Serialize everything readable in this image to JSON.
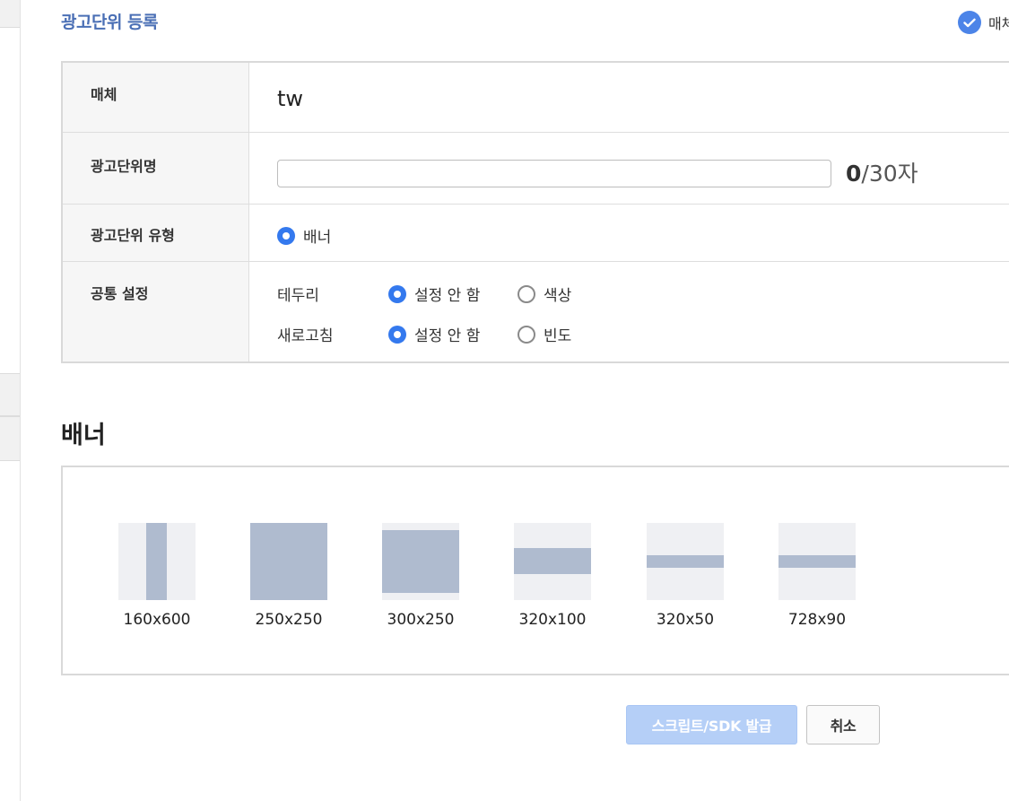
{
  "page": {
    "title": "광고단위 등록",
    "top_right_label": "매체"
  },
  "form": {
    "media": {
      "label": "매체",
      "value": "tw"
    },
    "unit_name": {
      "label": "광고단위명",
      "value": "",
      "placeholder": "",
      "count_current": "0",
      "count_suffix": "/30자"
    },
    "unit_type": {
      "label": "광고단위 유형",
      "option": "배너",
      "selected": true
    },
    "common": {
      "label": "공통 설정",
      "border": {
        "label": "테두리",
        "options": [
          "설정 안 함",
          "색상"
        ],
        "selected": "설정 안 함"
      },
      "refresh": {
        "label": "새로고침",
        "options": [
          "설정 안 함",
          "빈도"
        ],
        "selected": "설정 안 함"
      }
    }
  },
  "banner": {
    "title": "배너",
    "sizes": [
      "160x600",
      "250x250",
      "300x250",
      "320x100",
      "320x50",
      "728x90"
    ]
  },
  "buttons": {
    "issue": "스크립트/SDK 발급",
    "cancel": "취소"
  },
  "colors": {
    "accent": "#3479ee",
    "title": "#4a6fb5",
    "thumb_fill": "#afbbcf",
    "thumb_bg": "#eff0f3",
    "primary_disabled": "#b5cff7"
  }
}
